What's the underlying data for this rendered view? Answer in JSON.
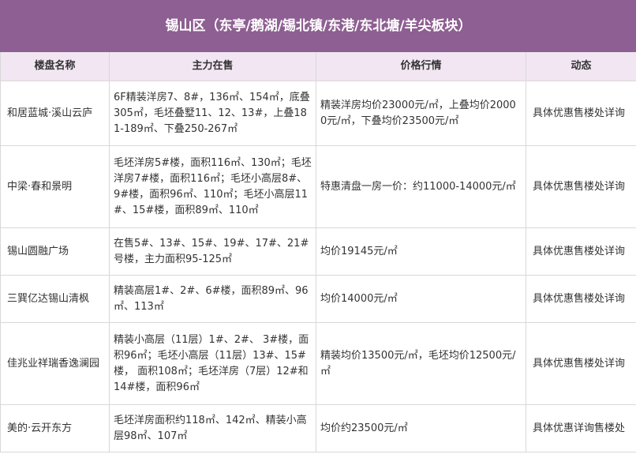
{
  "title": "锡山区（东亭/鹅湖/锡北镇/东港/东北塘/羊尖板块）",
  "headers": [
    "楼盘名称",
    "主力在售",
    "价格行情",
    "动态"
  ],
  "rows": [
    {
      "name": "和居蓝城·溪山云庐",
      "sale": "6F精装洋房7、8#，136㎡、154㎡，底叠305㎡，毛坯叠墅11、12、13#，上叠181-189㎡、下叠250-267㎡",
      "price": "精装洋房均价23000元/㎡，上叠均价20000元/㎡，下叠均价23500元/㎡",
      "status": "具体优惠售楼处详询"
    },
    {
      "name": "中梁·春和景明",
      "sale": "毛坯洋房5#楼，面积116㎡、130㎡；毛坯洋房7#楼，面积116㎡；毛坯小高层8#、9#楼，面积96㎡、110㎡；毛坯小高层11#、15#楼，面积89㎡、110㎡",
      "price": "特惠清盘一房一价：约11000-14000元/㎡",
      "status": "具体优惠售楼处详询"
    },
    {
      "name": "锡山圆融广场",
      "sale": "在售5#、13#、15#、19#、17#、21#号楼，主力面积95-125㎡",
      "price": "均价19145元/㎡",
      "status": "具体优惠售楼处详询"
    },
    {
      "name": "三巽亿达锡山清枫",
      "sale": "精装高层1#、2#、6#楼，面积89㎡、96㎡、113㎡",
      "price": "均价14000元/㎡",
      "status": "具体优惠售楼处详询"
    },
    {
      "name": "佳兆业祥瑞香逸澜园",
      "sale": "精装小高层（11层）1#、2#、 3#楼，面积96㎡；毛坯小高层（11层）13#、15#楼， 面积108㎡；毛坯洋房（7层）12#和14#楼，面积96㎡",
      "price": "精装均价13500元/㎡，毛坯均价12500元/㎡",
      "status": "具体优惠售楼处详询"
    },
    {
      "name": "美的·云开东方",
      "sale": "毛坯洋房面积约118㎡、142㎡、精装小高层98㎡、107㎡",
      "price": "均价约23500元/㎡",
      "status": "具体优惠详询售楼处"
    }
  ]
}
